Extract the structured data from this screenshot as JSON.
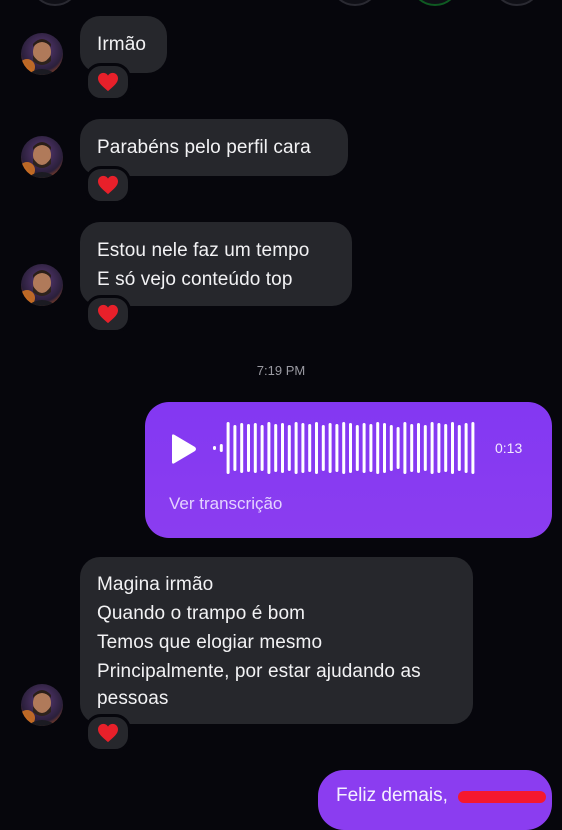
{
  "conversation": {
    "messages": [
      {
        "lines": [
          "Irmão"
        ],
        "reaction": "heart"
      },
      {
        "lines": [
          "Parabéns pelo perfil cara"
        ],
        "reaction": "heart"
      },
      {
        "lines": [
          "Estou nele faz um tempo",
          "E só vejo conteúdo top"
        ],
        "reaction": "heart"
      },
      {
        "lines": [
          "Magina irmão",
          "Quando o trampo é bom",
          "Temos que elogiar mesmo",
          "Principalmente, por estar ajudando as",
          "pessoas"
        ],
        "reaction": "heart"
      }
    ],
    "timestamp": "7:19 PM",
    "voice_message": {
      "duration": "0:13",
      "transcript_link": "Ver transcrição",
      "icon": "play-icon"
    },
    "outgoing_text": {
      "text": "Feliz demais,"
    }
  },
  "icons": {
    "reaction": "heart-icon",
    "play": "play-icon"
  },
  "colors": {
    "background": "#06060c",
    "incoming_bubble": "#26272c",
    "outgoing_bubble": "#8b3df0",
    "heart": "#e8202a",
    "redaction": "#f5182e"
  }
}
